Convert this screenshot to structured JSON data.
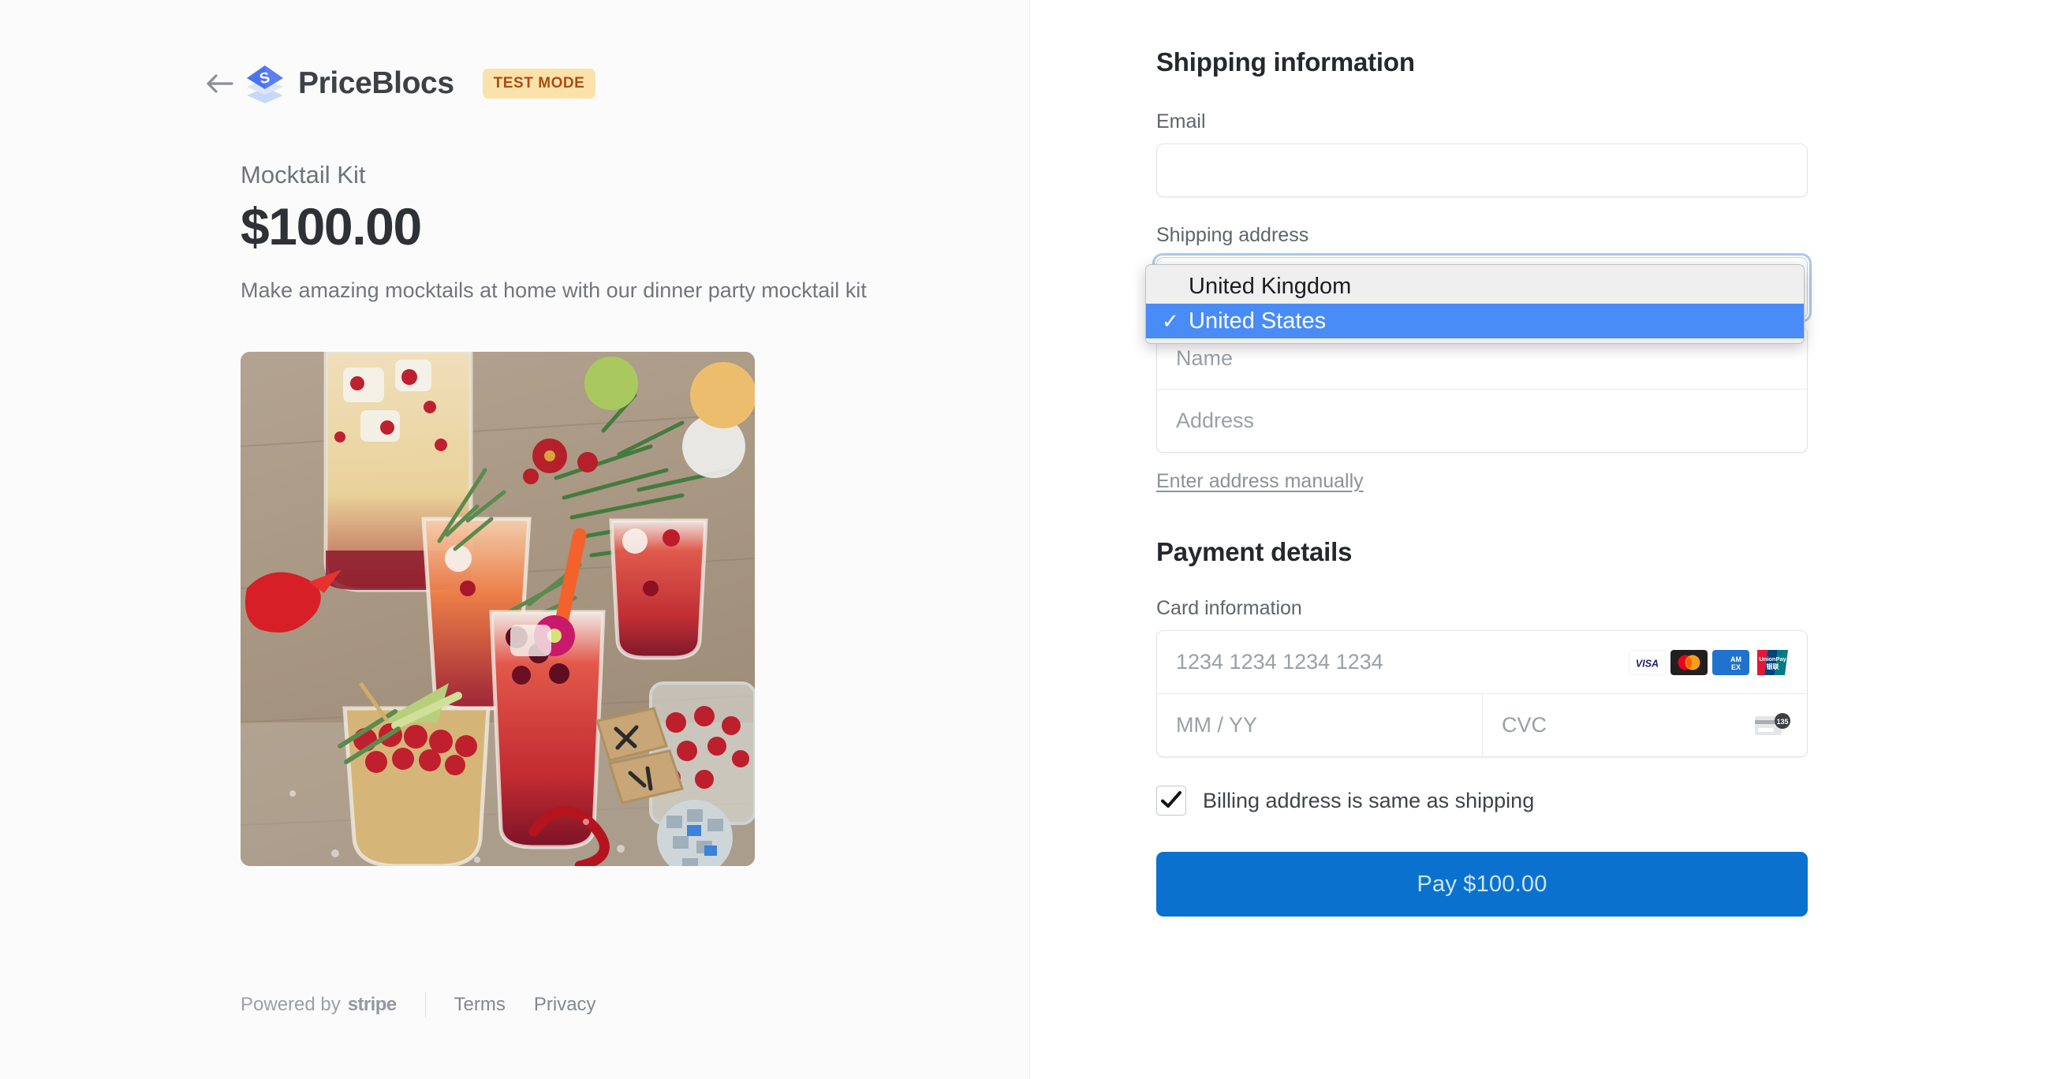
{
  "brand": {
    "name": "PriceBlocs",
    "badge": "TEST MODE",
    "back_icon": "back-arrow-icon",
    "logo_icon": "priceblocs-logo-icon"
  },
  "product": {
    "name": "Mocktail Kit",
    "price": "$100.00",
    "description": "Make amazing mocktails at home with our dinner party mocktail kit",
    "image_alt": "Festive cranberry mocktails with rosemary on a rustic wooden table"
  },
  "footer": {
    "powered_by": "Powered by",
    "stripe": "stripe",
    "terms": "Terms",
    "privacy": "Privacy"
  },
  "shipping": {
    "heading": "Shipping information",
    "email_label": "Email",
    "email_value": "",
    "email_placeholder": "",
    "address_label": "Shipping address",
    "country_value": "United States",
    "name_placeholder": "Name",
    "address_placeholder": "Address",
    "manual_link": "Enter address manually"
  },
  "country_dropdown": {
    "open": true,
    "options": [
      {
        "label": "United Kingdom",
        "selected": false,
        "check": ""
      },
      {
        "label": "United States",
        "selected": true,
        "check": "✓"
      }
    ]
  },
  "payment": {
    "heading": "Payment details",
    "card_label": "Card information",
    "card_number_placeholder": "1234 1234 1234 1234",
    "expiry_placeholder": "MM / YY",
    "cvc_placeholder": "CVC",
    "cvc_hint": "135",
    "brands": [
      "visa-icon",
      "mastercard-icon",
      "amex-icon",
      "unionpay-icon"
    ],
    "billing_checkbox_label": "Billing address is same as shipping",
    "billing_checkbox_checked": true,
    "pay_button": "Pay $100.00"
  },
  "colors": {
    "accent_blue": "#0a72ce",
    "selection_blue": "#4a8cf7",
    "badge_bg": "#fbe2ab",
    "badge_text": "#ad4c0e",
    "focus_ring": "#a9c9ef"
  }
}
